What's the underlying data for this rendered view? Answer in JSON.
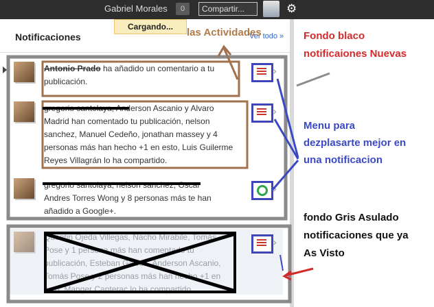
{
  "topbar": {
    "user_name": "Gabriel Morales",
    "notif_count": "0",
    "share_label": "Compartir..."
  },
  "panel": {
    "title": "Notificaciones",
    "loading": "Cargando...",
    "see_all": "Ver todo »",
    "items": [
      {
        "text_before": "Antonio Prado",
        "text_after": " ha añadido un comentario a tu publicación.",
        "icon": "list-icon"
      },
      {
        "line1": "gregorio santolaya, Anderson Ascanio y Alvaro",
        "line2": "Madrid han comentado tu publicación, nelson",
        "line3": "sanchez, Manuel Cedeño, jonathan massey y 4",
        "line4": "personas más han hecho +1 en esto, Luis Guilerme",
        "line5": "Reyes Villagrán lo ha compartido.",
        "icon": "list-icon"
      },
      {
        "line1": "gregorio santolaya, nelson sanchez, Oscar",
        "line2": "Andres Torres Wong y 8 personas más te han",
        "line3": "añadido a Google+.",
        "icon": "circle-icon"
      },
      {
        "line1": "Quentin Ojeda Villegas, Nacho Mirabile, Tomás",
        "line2": "Pose y 1 persona más han comentado tu",
        "line3": "publicación, Esteban Gálvez, Anderson Ascanio,",
        "line4": "Tomás Pose y 2 personas más han hecho +1 en",
        "line5": "esto, Manger Canterac lo ha compartido.",
        "icon": "list-icon"
      }
    ]
  },
  "annotations": {
    "activities": "las Actividades",
    "white_bg_1": "Fondo blaco",
    "white_bg_2": "notificaiones Nuevas",
    "menu_1": "Menu para",
    "menu_2": "dezplasarte mejor en",
    "menu_3": "una notificacion",
    "gray_1": "fondo Gris Asulado",
    "gray_2": "notificaciones que ya",
    "gray_3": "As Visto"
  },
  "colors": {
    "annotation_red": "#d12b2b",
    "annotation_blue": "#3b49c4",
    "annotation_brown": "#b07a4a",
    "outline_gray": "#8a8a8a"
  }
}
